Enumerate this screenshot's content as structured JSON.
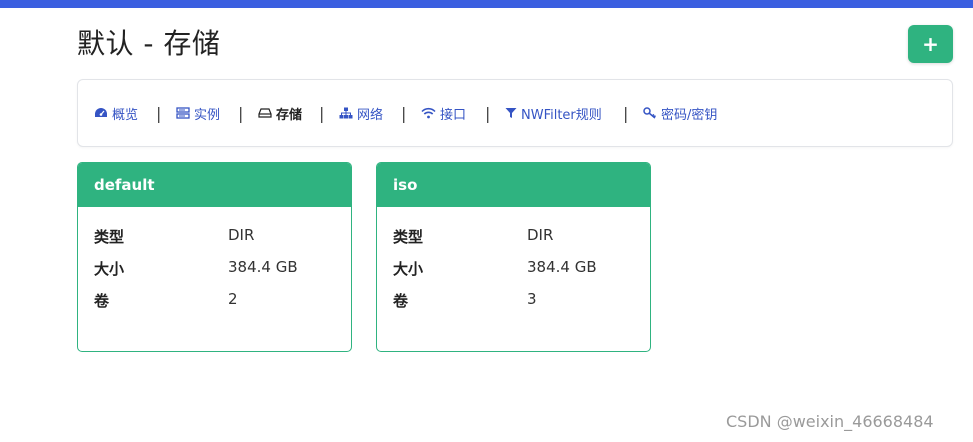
{
  "header": {
    "title": "默认 - 存储",
    "add_label": "+"
  },
  "nav": {
    "items": [
      {
        "label": "概览",
        "icon": "dashboard-icon",
        "active": false
      },
      {
        "label": "实例",
        "icon": "server-icon",
        "active": false
      },
      {
        "label": "存储",
        "icon": "hdd-icon",
        "active": true
      },
      {
        "label": "网络",
        "icon": "sitemap-icon",
        "active": false
      },
      {
        "label": "接口",
        "icon": "wifi-icon",
        "active": false
      },
      {
        "label": "NWFilter规则",
        "icon": "filter-icon",
        "active": false
      },
      {
        "label": "密码/密钥",
        "icon": "key-icon",
        "active": false
      }
    ],
    "separator": "|"
  },
  "pools": [
    {
      "name": "default",
      "rows": [
        {
          "key": "类型",
          "value": "DIR"
        },
        {
          "key": "大小",
          "value": "384.4 GB"
        },
        {
          "key": "卷",
          "value": "2"
        }
      ]
    },
    {
      "name": "iso",
      "rows": [
        {
          "key": "类型",
          "value": "DIR"
        },
        {
          "key": "大小",
          "value": "384.4 GB"
        },
        {
          "key": "卷",
          "value": "3"
        }
      ]
    }
  ],
  "watermark": "CSDN @weixin_46668484",
  "colors": {
    "accent": "#2fb380",
    "topbar": "#3b5fe0",
    "link": "#3554c4"
  }
}
